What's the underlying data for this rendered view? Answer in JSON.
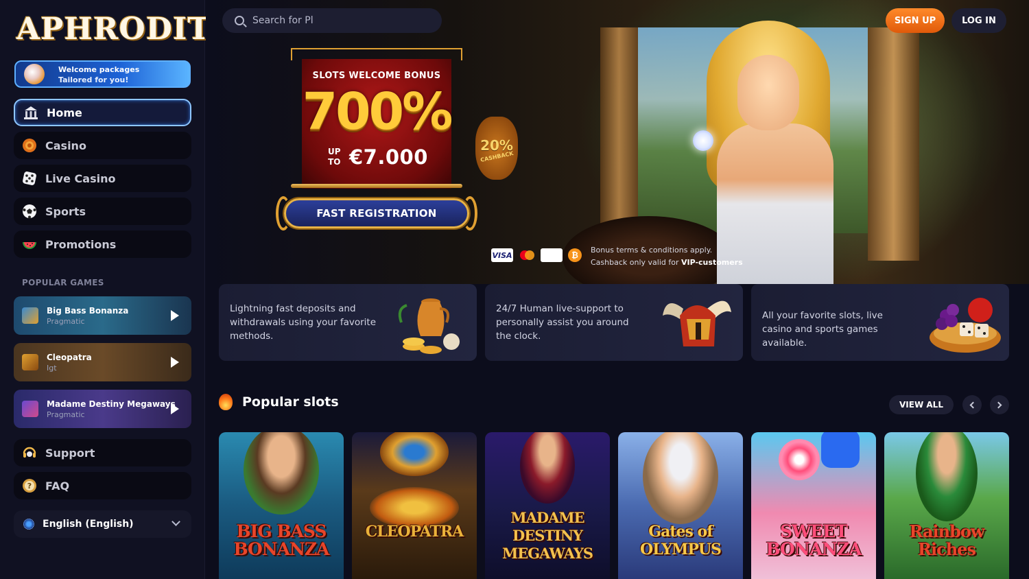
{
  "brand": {
    "logo_text": "APHRODITE"
  },
  "welcome": {
    "line1": "Welcome packages",
    "line2": "Tailored for you!"
  },
  "nav": {
    "items": [
      {
        "label": "Home",
        "icon": "temple-icon"
      },
      {
        "label": "Casino",
        "icon": "chip-icon"
      },
      {
        "label": "Live Casino",
        "icon": "dice-icon"
      },
      {
        "label": "Sports",
        "icon": "soccer-ball-icon"
      },
      {
        "label": "Promotions",
        "icon": "watermelon-icon"
      }
    ]
  },
  "popular_games": {
    "title": "POPULAR GAMES",
    "items": [
      {
        "title": "Big Bass Bonanza",
        "provider": "Pragmatic"
      },
      {
        "title": "Cleopatra",
        "provider": "Igt"
      },
      {
        "title": "Madame Destiny Megaways",
        "provider": "Pragmatic"
      }
    ]
  },
  "support": {
    "support_label": "Support",
    "faq_label": "FAQ"
  },
  "language": {
    "label": "English (English)"
  },
  "header": {
    "search_placeholder": "Search for Pl",
    "signup_label": "SIGN UP",
    "login_label": "LOG IN"
  },
  "hero": {
    "bonus_subtitle": "SLOTS WELCOME BONUS",
    "bonus_percent": "700%",
    "up_to_line1": "UP",
    "up_to_line2": "TO",
    "bonus_amount": "€7.000",
    "cta_label": "FAST REGISTRATION",
    "cashback_percent": "20%",
    "cashback_label": "CASHBACK",
    "terms_line1": "Bonus terms & conditions apply.",
    "terms_line2_prefix": "Cashback only valid for ",
    "terms_line2_bold": "VIP-customers",
    "terms_line2_suffix": ".",
    "payments": [
      "VISA",
      "mastercard",
      "Pay",
      "₿"
    ]
  },
  "features": [
    {
      "text": "Lightning fast deposits and withdrawals using your favorite methods."
    },
    {
      "text": "24/7 Human live-support to personally assist you around the clock."
    },
    {
      "text": "All your favorite slots, live casino and sports games available."
    }
  ],
  "slots": {
    "title": "Popular slots",
    "view_all_label": "VIEW ALL",
    "items": [
      {
        "name": "BIG BASS BONANZA",
        "color": "#e8452a"
      },
      {
        "name": "CLEOPATRA",
        "color": "#e9b23a"
      },
      {
        "name": "MADAME DESTINY MEGAWAYS",
        "color": "#f2c14e"
      },
      {
        "name": "Gates of OLYMPUS",
        "color": "#f6c84a"
      },
      {
        "name": "SWEET BONANZA",
        "color": "#ff4d7a"
      },
      {
        "name": "Rainbow Riches",
        "color": "#e8452a"
      }
    ]
  },
  "colors": {
    "accent_orange": "#ff8a2a",
    "bg": "#0c0d1c",
    "sidebar": "#101122",
    "active_border": "#8fc6ff"
  }
}
